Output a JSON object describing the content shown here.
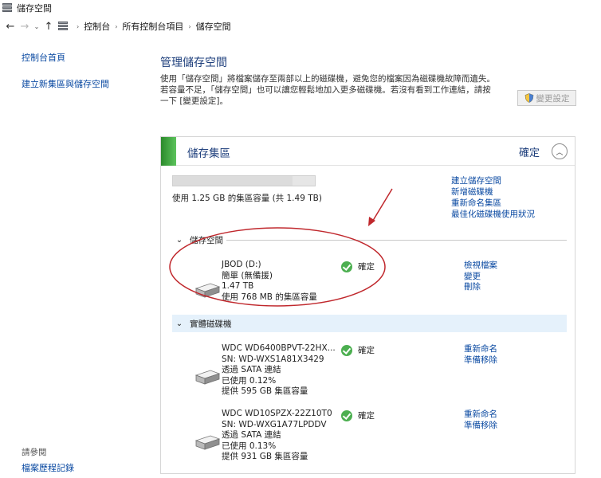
{
  "window": {
    "title": "儲存空間"
  },
  "address": {
    "back_icon": "←",
    "forward_icon": "→",
    "recent_icon": "⌄",
    "up_icon": "↑",
    "separator": "›",
    "crumbs": [
      "控制台",
      "所有控制台項目",
      "儲存空間"
    ]
  },
  "sidebar": {
    "home": "控制台首頁",
    "create": "建立新集區與儲存空間",
    "see_also": "請參閱",
    "file_history": "檔案歷程記錄"
  },
  "main": {
    "title": "管理儲存空間",
    "description_line1": "使用「儲存空間」將檔案儲存至兩部以上的磁碟機，避免您的檔案因為磁碟機故障而遺失。",
    "description_line2": "若容量不足，「儲存空間」也可以讓您輕鬆地加入更多磁碟機。若沒有看到工作連結，請按",
    "description_line3": "一下 [變更設定]。",
    "change_settings": "變更設定"
  },
  "pool": {
    "name": "儲存集區",
    "status": "確定",
    "collapse_icon": "︿",
    "used_fraction": 0.84,
    "usage_text": "使用 1.25 GB 的集區容量 (共 1.49 TB)",
    "actions": [
      "建立儲存空間",
      "新增磁碟機",
      "重新命名集區",
      "最佳化磁碟機使用狀況"
    ],
    "spaces_section": {
      "chevron": "⌄",
      "label": "儲存空間",
      "items": [
        {
          "name": "JBOD (D:)",
          "resiliency": "簡單 (無備援)",
          "size": "1.47 TB",
          "usage": "使用 768 MB 的集區容量",
          "status": "確定",
          "actions": [
            "檢視檔案",
            "變更",
            "刪除"
          ]
        }
      ]
    },
    "disks_section": {
      "chevron": "⌄",
      "label": "實體磁碟機",
      "items": [
        {
          "name": "WDC WD6400BPVT-22HX...",
          "serial": "SN: WD-WXS1A81X3429",
          "connection": "透過 SATA 連結",
          "used": "已使用 0.12%",
          "capacity": "提供 595 GB 集區容量",
          "status": "確定",
          "actions": [
            "重新命名",
            "準備移除"
          ]
        },
        {
          "name": "WDC WD10SPZX-22Z10T0",
          "serial": "SN: WD-WXG1A77LPDDV",
          "connection": "透過 SATA 連結",
          "used": "已使用 0.13%",
          "capacity": "提供 931 GB 集區容量",
          "status": "確定",
          "actions": [
            "重新命名",
            "準備移除"
          ]
        }
      ]
    }
  },
  "colors": {
    "link": "#0b4aa2",
    "heading": "#1e3f7c",
    "pool_accent": "#2b8a2b",
    "ok_green": "#4caf50",
    "annotation_red": "#c0282d",
    "section_highlight": "#e5f1fb"
  }
}
